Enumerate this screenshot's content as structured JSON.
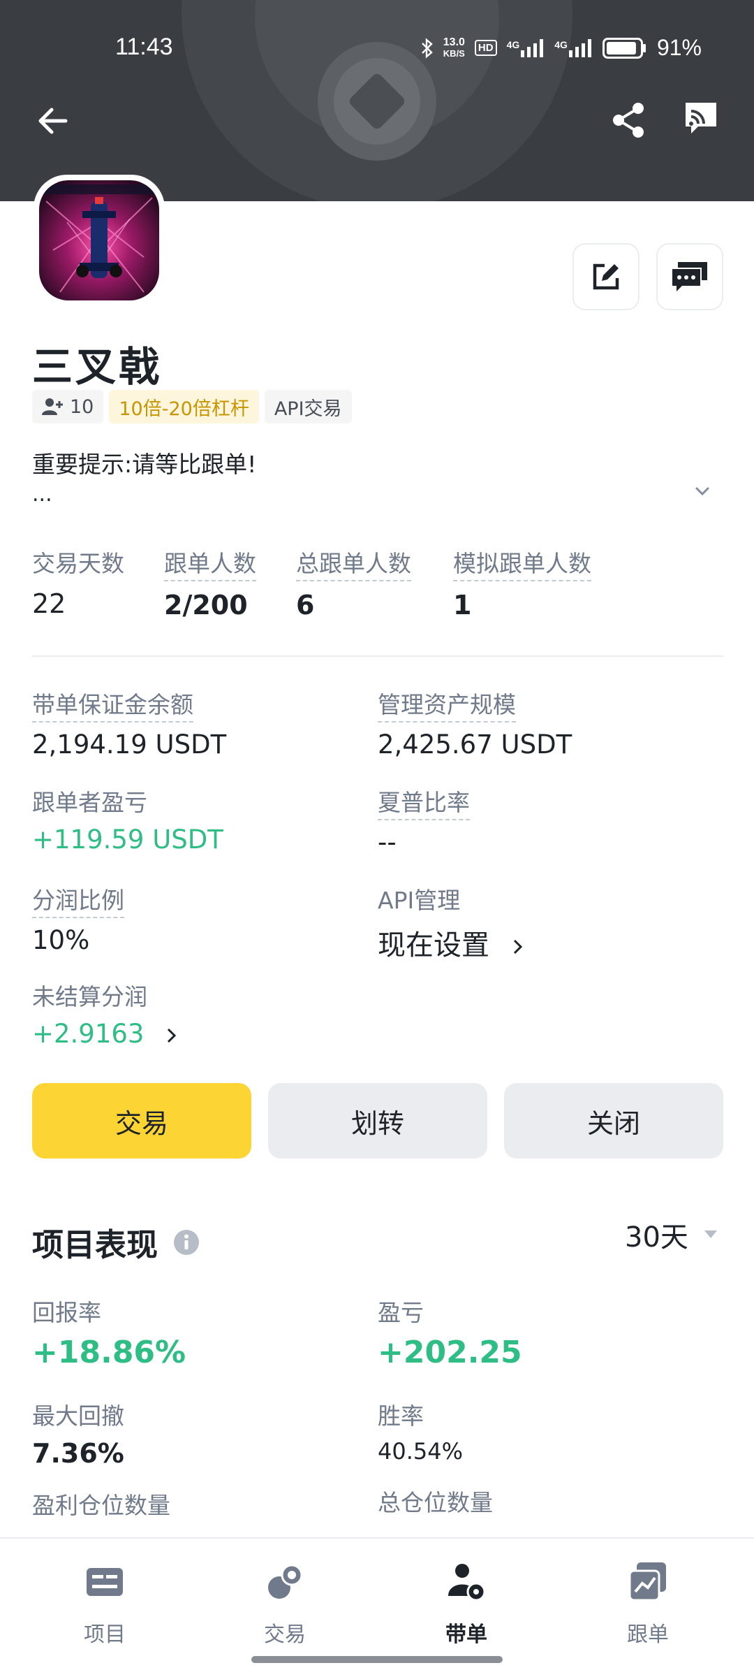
{
  "status_bar": {
    "time": "11:43",
    "net_speed_value": "13.0",
    "net_speed_unit": "KB/S",
    "hd_badge": "HD",
    "signal1_label": "4G",
    "signal2_label": "4G",
    "battery_percent": "91%",
    "battery_level": 0.91
  },
  "header": {
    "back_icon": "arrow-left-icon",
    "share_icon": "share-icon",
    "cast_icon": "cast-icon"
  },
  "profile": {
    "name": "三叉戟",
    "followers": "10",
    "tags": [
      "10倍-20倍杠杆",
      "API交易"
    ],
    "notice": "重要提示:请等比跟单!",
    "notice_more": "...",
    "edit_icon": "edit-icon",
    "chat_icon": "chat-icon"
  },
  "stats": [
    {
      "label": "交易天数",
      "value": "22"
    },
    {
      "label": "跟单人数",
      "value": "2/200"
    },
    {
      "label": "总跟单人数",
      "value": "6"
    },
    {
      "label": "模拟跟单人数",
      "value": "1"
    }
  ],
  "details": {
    "margin_balance_label": "带单保证金余额",
    "margin_balance_value": "2,194.19 USDT",
    "aum_label": "管理资产规模",
    "aum_value": "2,425.67 USDT",
    "follower_pnl_label": "跟单者盈亏",
    "follower_pnl_value": "+119.59 USDT",
    "sharpe_label": "夏普比率",
    "sharpe_value": "--",
    "profit_share_label": "分润比例",
    "profit_share_value": "10%",
    "api_label": "API管理",
    "api_value": "现在设置",
    "unsettled_label": "未结算分润",
    "unsettled_value": "+2.9163"
  },
  "actions": {
    "trade": "交易",
    "transfer": "划转",
    "close": "关闭"
  },
  "performance": {
    "title": "项目表现",
    "period": "30天",
    "roi_label": "回报率",
    "roi_value": "+18.86%",
    "pnl_label": "盈亏",
    "pnl_value": "+202.25",
    "mdd_label": "最大回撤",
    "mdd_value": "7.36%",
    "winrate_label": "胜率",
    "winrate_value": "40.54%",
    "profit_pos_label": "盈利仓位数量",
    "total_pos_label": "总仓位数量"
  },
  "bottom_nav": [
    {
      "label": "项目",
      "icon": "project-icon",
      "active": false
    },
    {
      "label": "交易",
      "icon": "trade-icon",
      "active": false
    },
    {
      "label": "带单",
      "icon": "lead-icon",
      "active": true
    },
    {
      "label": "跟单",
      "icon": "copy-trade-icon",
      "active": false
    }
  ],
  "colors": {
    "accent_yellow": "#fcd535",
    "positive_green": "#2ebd85",
    "leverage_tag_text": "#c99400",
    "text_primary": "#1e2329",
    "text_secondary": "#707a8a"
  }
}
